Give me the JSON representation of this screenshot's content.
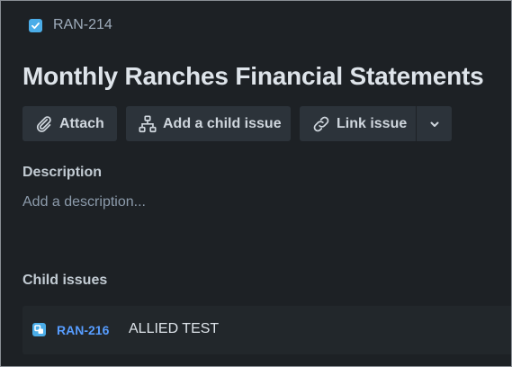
{
  "issue": {
    "key": "RAN-214",
    "type_icon": "checkbox-task-icon",
    "title": "Monthly Ranches Financial Statements"
  },
  "toolbar": {
    "attach_label": "Attach",
    "add_child_label": "Add a child issue",
    "link_issue_label": "Link issue"
  },
  "description": {
    "heading": "Description",
    "placeholder": "Add a description..."
  },
  "child_issues": {
    "heading": "Child issues",
    "items": [
      {
        "key": "RAN-216",
        "summary": "ALLIED TEST",
        "type_icon": "subtask-icon"
      }
    ]
  },
  "colors": {
    "background": "#1d2125",
    "button": "#2c333a",
    "accent_link": "#579dff",
    "icon_blue": "#4bade8"
  }
}
